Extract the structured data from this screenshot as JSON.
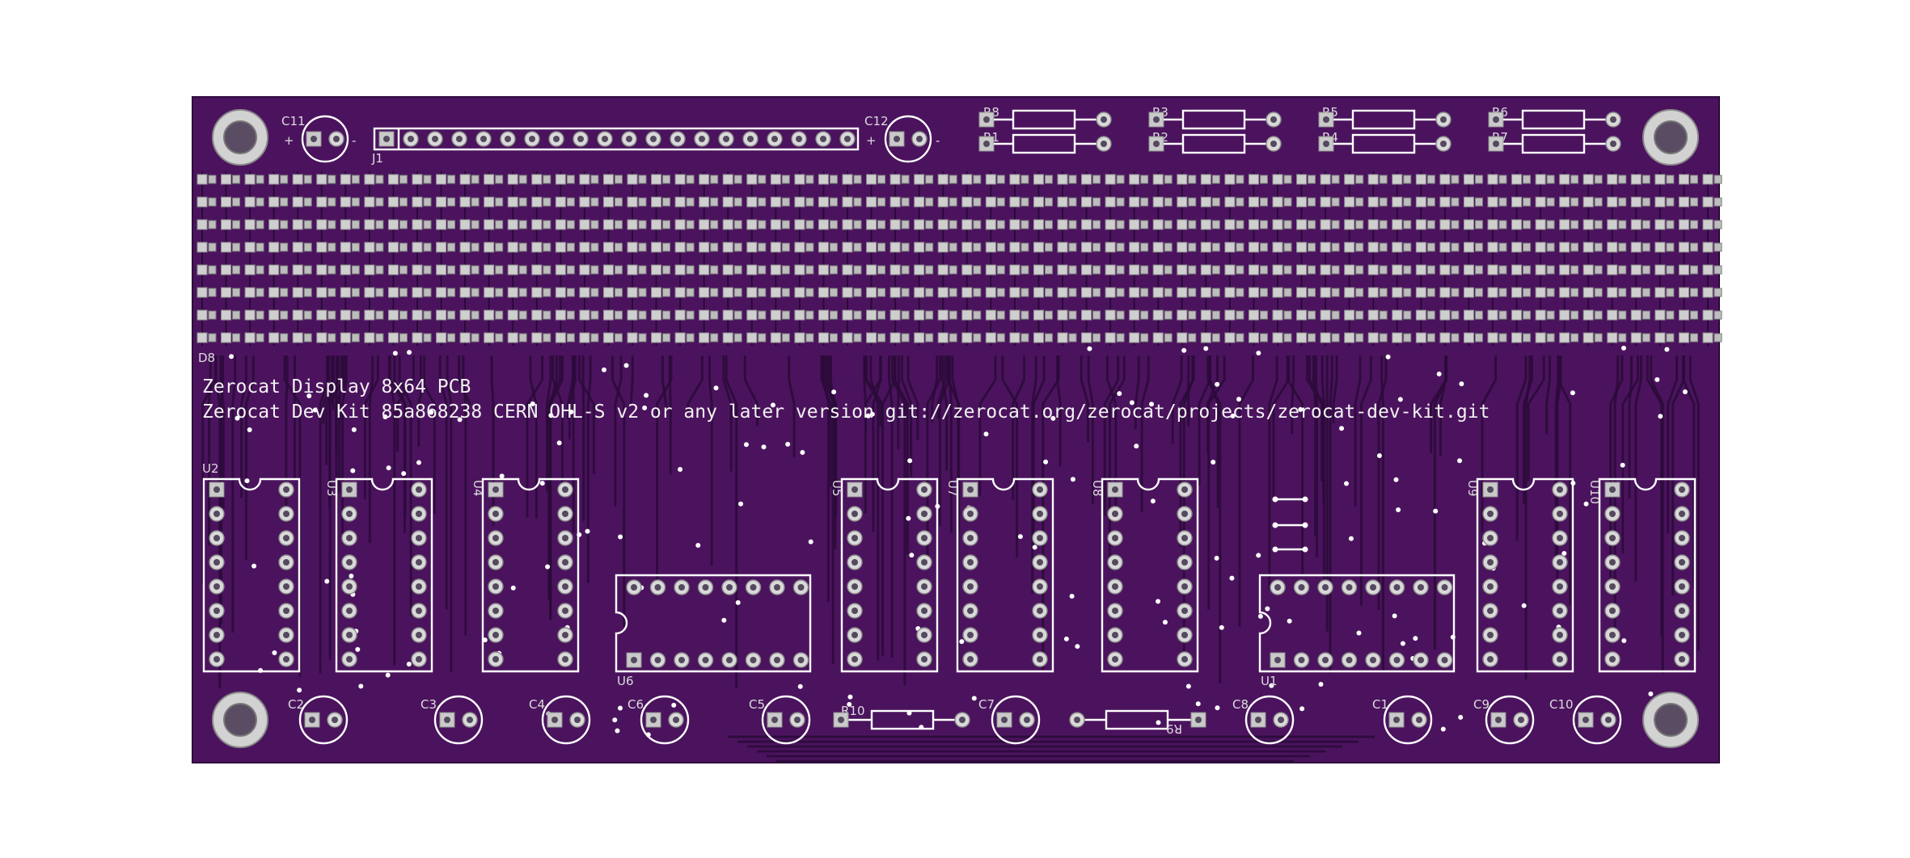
{
  "board": {
    "title_line": "Zerocat Display 8x64 PCB",
    "info_line": "Zerocat Dev Kit  85a868238  CERN OHL-S v2 or any later version  git://zerocat.org/zerocat/projects/zerocat-dev-kit.git",
    "colors": {
      "board": "#4b135e",
      "silkscreen": "#ffffff",
      "pad": "#cfcfcf",
      "trace": "#2a0a38"
    }
  },
  "connector": {
    "ref": "J1"
  },
  "led_matrix": {
    "ref": "D8"
  },
  "resistors_top": [
    {
      "ref": "R8"
    },
    {
      "ref": "R1"
    },
    {
      "ref": "R3"
    },
    {
      "ref": "R2"
    },
    {
      "ref": "R5"
    },
    {
      "ref": "R4"
    },
    {
      "ref": "R6"
    },
    {
      "ref": "R7"
    }
  ],
  "resistors_bottom": [
    {
      "ref": "R10"
    },
    {
      "ref": "R9"
    }
  ],
  "ics": [
    {
      "ref": "U2"
    },
    {
      "ref": "U3"
    },
    {
      "ref": "U4"
    },
    {
      "ref": "U6"
    },
    {
      "ref": "U5"
    },
    {
      "ref": "U7"
    },
    {
      "ref": "U8"
    },
    {
      "ref": "U1"
    },
    {
      "ref": "U9"
    },
    {
      "ref": "U10"
    }
  ],
  "capacitors_top": [
    {
      "ref": "C11",
      "plus": "+",
      "minus": "-"
    },
    {
      "ref": "C12",
      "plus": "+",
      "minus": "-"
    }
  ],
  "capacitors_bottom": [
    {
      "ref": "C2"
    },
    {
      "ref": "C3"
    },
    {
      "ref": "C4"
    },
    {
      "ref": "C6"
    },
    {
      "ref": "C5"
    },
    {
      "ref": "C7"
    },
    {
      "ref": "C8"
    },
    {
      "ref": "C1"
    },
    {
      "ref": "C9"
    },
    {
      "ref": "C10"
    }
  ],
  "mounting_holes": [
    {
      "name": "mounting-hole-top-left"
    },
    {
      "name": "mounting-hole-top-right"
    },
    {
      "name": "mounting-hole-bottom-left"
    },
    {
      "name": "mounting-hole-bottom-right"
    }
  ]
}
